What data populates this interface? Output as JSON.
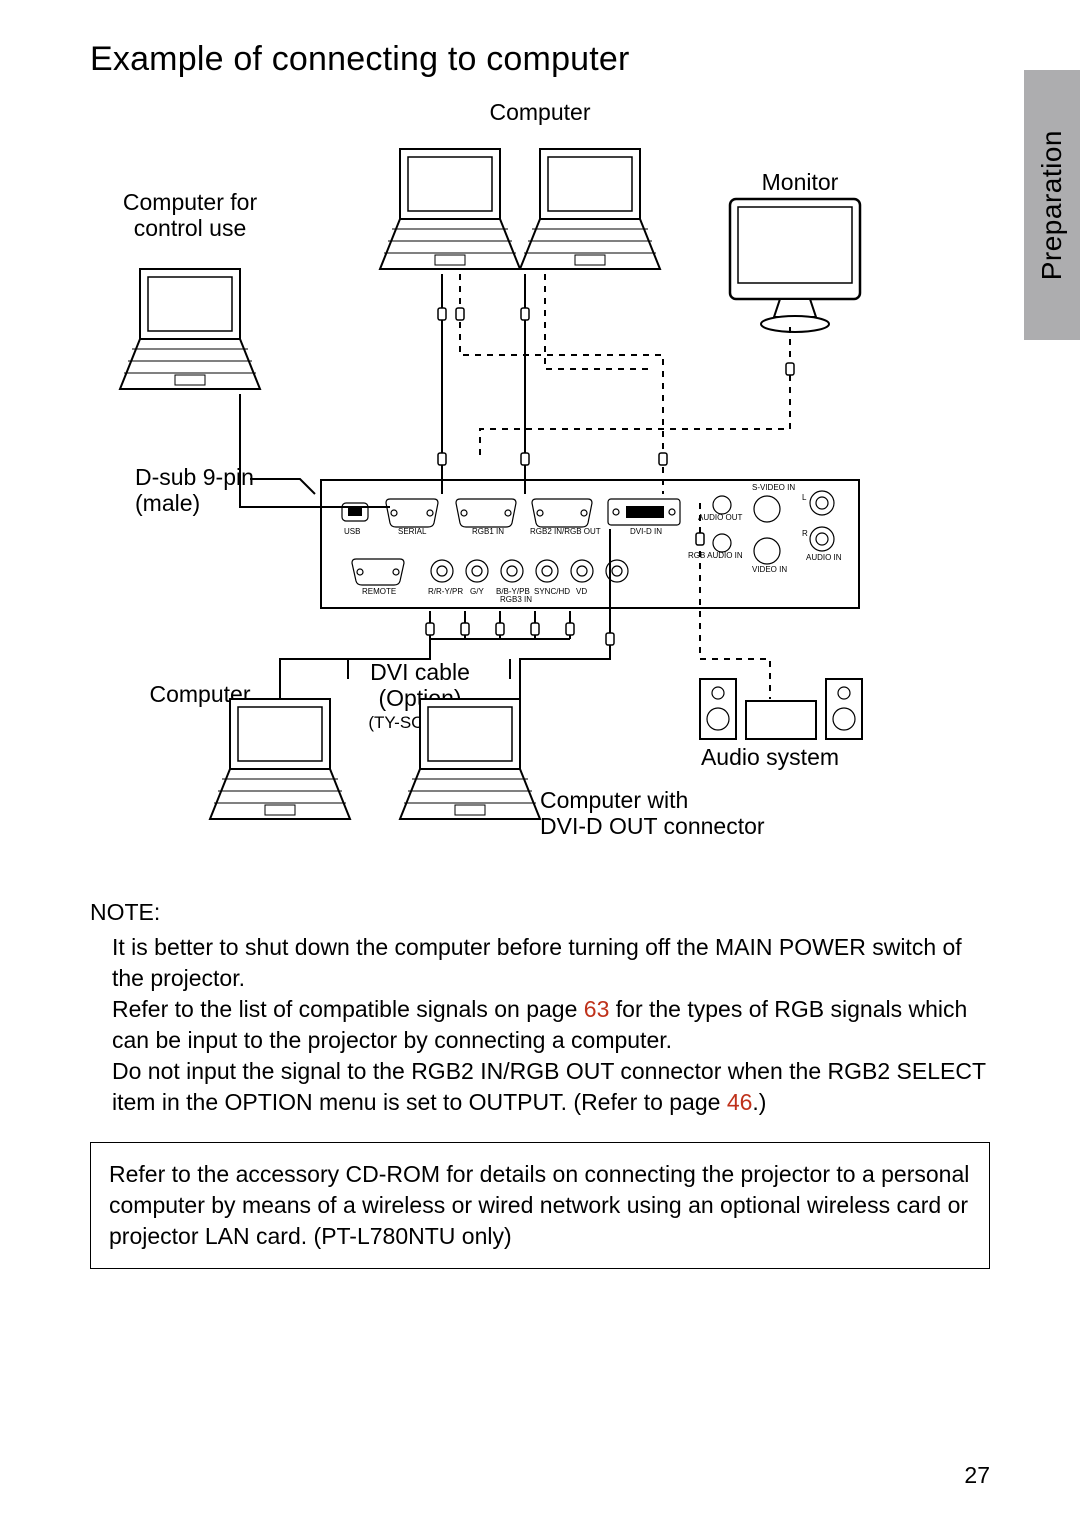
{
  "section_tab": "Preparation",
  "title": "Example of connecting to computer",
  "labels": {
    "computer_top": "Computer",
    "computer_ctrl": "Computer for\ncontrol use",
    "monitor": "Monitor",
    "dsub": "D-sub 9-pin\n(male)",
    "dvi_cable": "DVI cable\n(Option)",
    "dvi_part": "(TY-SCDV03)",
    "computer_bl": "Computer",
    "audio": "Audio system",
    "computer_dvi": "Computer with\nDVI-D OUT connector"
  },
  "panel_ports": {
    "usb": "USB",
    "serial": "SERIAL",
    "rgb1": "RGB1 IN",
    "rgb2": "RGB2 IN/RGB OUT",
    "dvid": "DVI-D IN",
    "audio_out": "AUDIO OUT",
    "rgb_audio_in": "RGB AUDIO IN",
    "svideo": "S-VIDEO IN",
    "video_in": "VIDEO IN",
    "audio_in": "AUDIO IN",
    "l": "L",
    "r": "R",
    "remote": "REMOTE",
    "r_pr": "R/R-Y/PR",
    "g_y": "G/Y",
    "b_pb": "B/B-Y/PB",
    "sync": "SYNC/HD",
    "vd": "VD",
    "rgb3": "RGB3 IN"
  },
  "note": {
    "heading": "NOTE:",
    "l1a": "It is better to shut down the computer before turning off the MAIN POWER switch of the projector.",
    "l2a": "Refer to the list of compatible signals on page ",
    "l2_ref": "63",
    "l2b": " for the types of RGB signals which can be input to the projector by connecting a computer.",
    "l3a": "Do not input the signal to the RGB2 IN/RGB OUT connector when the RGB2 SELECT item in the OPTION menu is set to OUTPUT. (Refer to page ",
    "l3_ref": "46",
    "l3b": ".)"
  },
  "info_box": "Refer to the accessory CD-ROM for details on connecting the projector to a personal computer by means of a wireless or wired network using an optional wireless card or projector LAN card. (PT-L780NTU only)",
  "page_number": "27"
}
